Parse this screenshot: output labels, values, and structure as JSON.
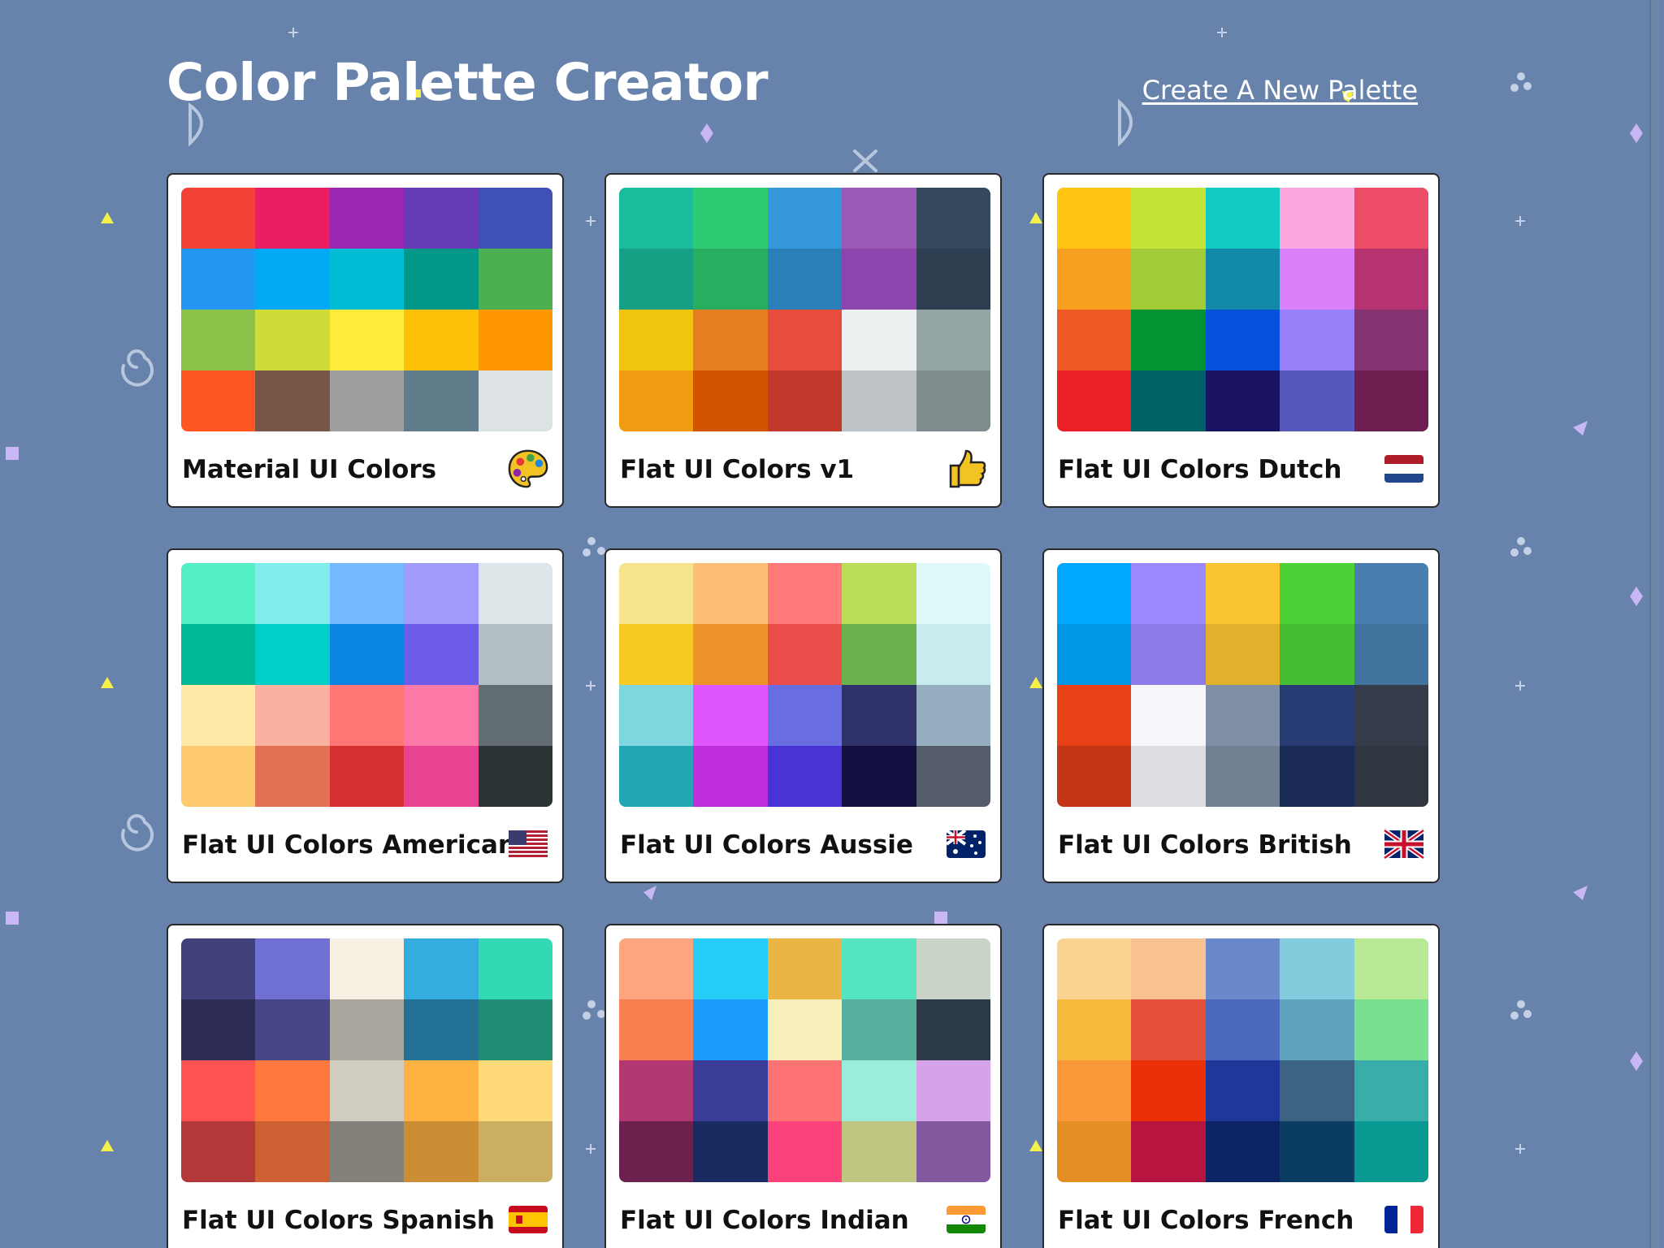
{
  "header": {
    "title": "Color Palette Creator",
    "new_link": "Create A New Palette"
  },
  "colors": {
    "background": "#6783ab",
    "card": "#ffffff"
  },
  "palettes": [
    {
      "name": "Material UI Colors",
      "emoji": "palette-icon",
      "colors": [
        "#f44336",
        "#e91e63",
        "#9c27b0",
        "#673ab7",
        "#3f51b5",
        "#2196f3",
        "#03a9f4",
        "#00bcd4",
        "#009688",
        "#4caf50",
        "#8bc34a",
        "#cddc39",
        "#ffeb3b",
        "#ffc107",
        "#ff9800",
        "#ff5722",
        "#795548",
        "#9e9e9e",
        "#607d8b",
        "#dde2e5"
      ]
    },
    {
      "name": "Flat UI Colors v1",
      "emoji": "thumbs-up-icon",
      "colors": [
        "#1abc9c",
        "#2ecc71",
        "#3498db",
        "#9b59b6",
        "#34495e",
        "#16a085",
        "#27ae60",
        "#2980b9",
        "#8e44ad",
        "#2c3e50",
        "#f1c40f",
        "#e67e22",
        "#e74c3c",
        "#ecf0f1",
        "#95a5a6",
        "#f39c12",
        "#d35400",
        "#c0392b",
        "#bdc3c7",
        "#7f8c8d"
      ]
    },
    {
      "name": "Flat UI Colors Dutch",
      "emoji": "flag-netherlands-icon",
      "colors": [
        "#ffc312",
        "#c4e538",
        "#12cbc4",
        "#fda7df",
        "#ed4c67",
        "#f79f1f",
        "#a3cb38",
        "#1289a7",
        "#d980fa",
        "#b53471",
        "#ee5a24",
        "#009432",
        "#0652dd",
        "#9980fa",
        "#833471",
        "#ea2027",
        "#006266",
        "#1b1464",
        "#5758bb",
        "#6f1e51"
      ]
    },
    {
      "name": "Flat UI Colors American",
      "emoji": "flag-usa-icon",
      "colors": [
        "#55efc4",
        "#81ecec",
        "#74b9ff",
        "#a29bfe",
        "#dfe6e9",
        "#00b894",
        "#00cec9",
        "#0984e3",
        "#6c5ce7",
        "#b2bec3",
        "#ffeaa7",
        "#fab1a0",
        "#ff7675",
        "#fd79a8",
        "#636e72",
        "#fdcb6e",
        "#e17055",
        "#d63031",
        "#e84393",
        "#2d3436"
      ]
    },
    {
      "name": "Flat UI Colors Aussie",
      "emoji": "flag-australia-icon",
      "colors": [
        "#f6e58d",
        "#ffbe76",
        "#ff7979",
        "#badc58",
        "#dff9fb",
        "#f9ca24",
        "#f0932b",
        "#eb4d4b",
        "#6ab04c",
        "#c7ecee",
        "#7ed6df",
        "#e056fd",
        "#686de0",
        "#30336b",
        "#95afc0",
        "#22a6b3",
        "#be2edd",
        "#4834d4",
        "#130f40",
        "#535c68"
      ]
    },
    {
      "name": "Flat UI Colors British",
      "emoji": "flag-uk-icon",
      "colors": [
        "#00a8ff",
        "#9c88ff",
        "#fbc531",
        "#4cd137",
        "#487eb0",
        "#0097e6",
        "#8c7ae6",
        "#e1b12c",
        "#44bd32",
        "#40739e",
        "#e84118",
        "#f5f6fa",
        "#7f8fa6",
        "#273c75",
        "#353b48",
        "#c23616",
        "#dcdde1",
        "#718093",
        "#192a56",
        "#2f3640"
      ]
    },
    {
      "name": "Flat UI Colors Spanish",
      "emoji": "flag-spain-icon",
      "colors": [
        "#40407a",
        "#706fd3",
        "#f7f1e3",
        "#34ace0",
        "#33d9b2",
        "#2c2c54",
        "#474787",
        "#aaa69d",
        "#227093",
        "#218c74",
        "#ff5252",
        "#ff793f",
        "#d1ccc0",
        "#ffb142",
        "#ffda79",
        "#b33939",
        "#cd6133",
        "#84817a",
        "#cc8e35",
        "#ccae62"
      ]
    },
    {
      "name": "Flat UI Colors Indian",
      "emoji": "flag-india-icon",
      "colors": [
        "#fea47f",
        "#25ccf7",
        "#eab543",
        "#55e6c1",
        "#cad3c8",
        "#f97f51",
        "#1b9cfc",
        "#f8efba",
        "#58b19f",
        "#2c3a47",
        "#b33771",
        "#3b3b98",
        "#fd7272",
        "#9aecdb",
        "#d6a2e8",
        "#6d214f",
        "#182c61",
        "#fc427b",
        "#bdc581",
        "#82589f"
      ]
    },
    {
      "name": "Flat UI Colors French",
      "emoji": "flag-france-icon",
      "colors": [
        "#fad390",
        "#f8c291",
        "#6a89cc",
        "#82ccdd",
        "#b8e994",
        "#f6b93b",
        "#e55039",
        "#4a69bd",
        "#60a3bc",
        "#78e08f",
        "#fa983a",
        "#eb2f06",
        "#1e3799",
        "#3c6382",
        "#38ada9",
        "#e58e26",
        "#b71540",
        "#0c2461",
        "#0a3d62",
        "#079992"
      ]
    }
  ]
}
